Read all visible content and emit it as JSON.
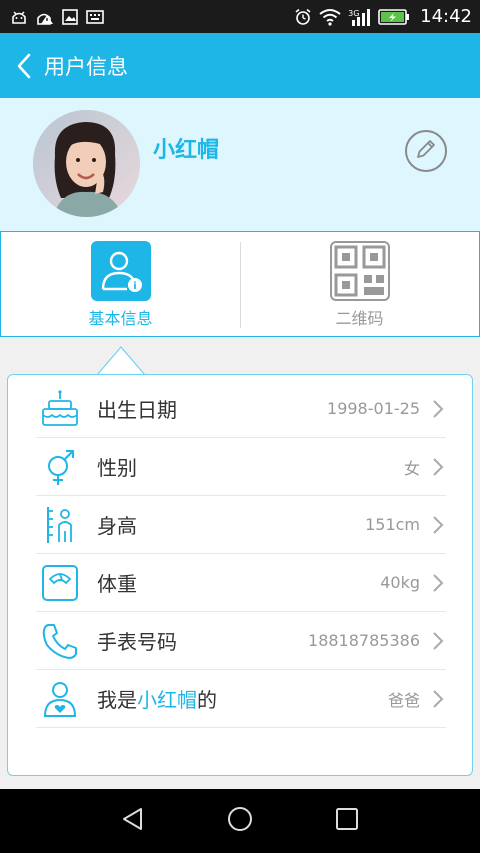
{
  "status_bar": {
    "time": "14:42",
    "network_label": "3G",
    "icons": [
      "android-debug-icon",
      "android-warning-icon",
      "image-icon",
      "keyboard-icon",
      "alarm-icon",
      "wifi-icon",
      "signal-icon",
      "battery-charging-icon"
    ]
  },
  "app_bar": {
    "title": "用户信息",
    "back_icon": "chevron-left-icon"
  },
  "profile": {
    "nickname": "小红帽",
    "edit_icon": "pencil-icon"
  },
  "tabs": [
    {
      "label": "基本信息",
      "icon": "person-info-icon",
      "active": true
    },
    {
      "label": "二维码",
      "icon": "qr-code-icon",
      "active": false
    }
  ],
  "rows": [
    {
      "icon": "cake-icon",
      "label": "出生日期",
      "value": "1998-01-25"
    },
    {
      "icon": "gender-icon",
      "label": "性别",
      "value": "女"
    },
    {
      "icon": "height-icon",
      "label": "身高",
      "value": "151cm"
    },
    {
      "icon": "scale-icon",
      "label": "体重",
      "value": "40kg"
    },
    {
      "icon": "phone-icon",
      "label": "手表号码",
      "value": "18818785386"
    },
    {
      "icon": "relation-icon",
      "label_prefix": "我是",
      "label_highlight": "小红帽",
      "label_suffix": "的",
      "value": "爸爸"
    }
  ],
  "colors": {
    "accent": "#1eb6e6",
    "header_bg": "#def6fd",
    "status_bg": "#1b1b1b"
  }
}
